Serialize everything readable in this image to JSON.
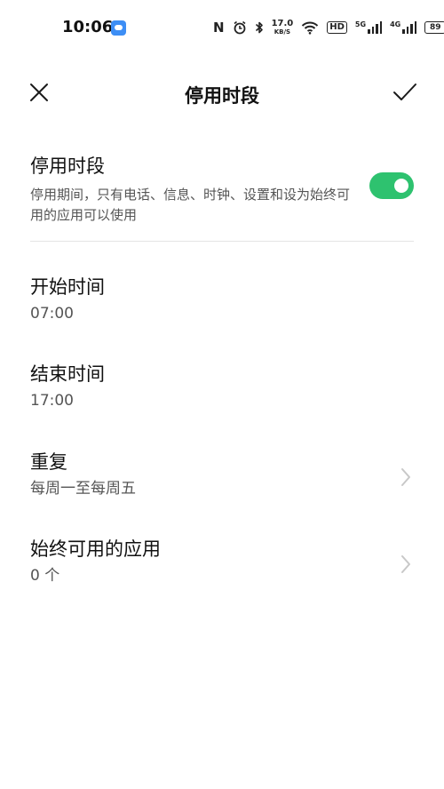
{
  "status_bar": {
    "time": "10:06",
    "speed_value": "17.0",
    "speed_unit": "KB/S",
    "hd_label": "HD",
    "net1": "5G",
    "net2": "4G",
    "battery": "89"
  },
  "header": {
    "title": "停用时段"
  },
  "toggle": {
    "title": "停用时段",
    "description": "停用期间，只有电话、信息、时钟、设置和设为始终可用的应用可以使用",
    "enabled": true
  },
  "items": [
    {
      "title": "开始时间",
      "value": "07:00",
      "has_chevron": false
    },
    {
      "title": "结束时间",
      "value": "17:00",
      "has_chevron": false
    },
    {
      "title": "重复",
      "value": "每周一至每周五",
      "has_chevron": true
    },
    {
      "title": "始终可用的应用",
      "value": "0 个",
      "has_chevron": true
    }
  ],
  "colors": {
    "accent": "#2ec26f",
    "chevron": "#c8c8c8"
  }
}
